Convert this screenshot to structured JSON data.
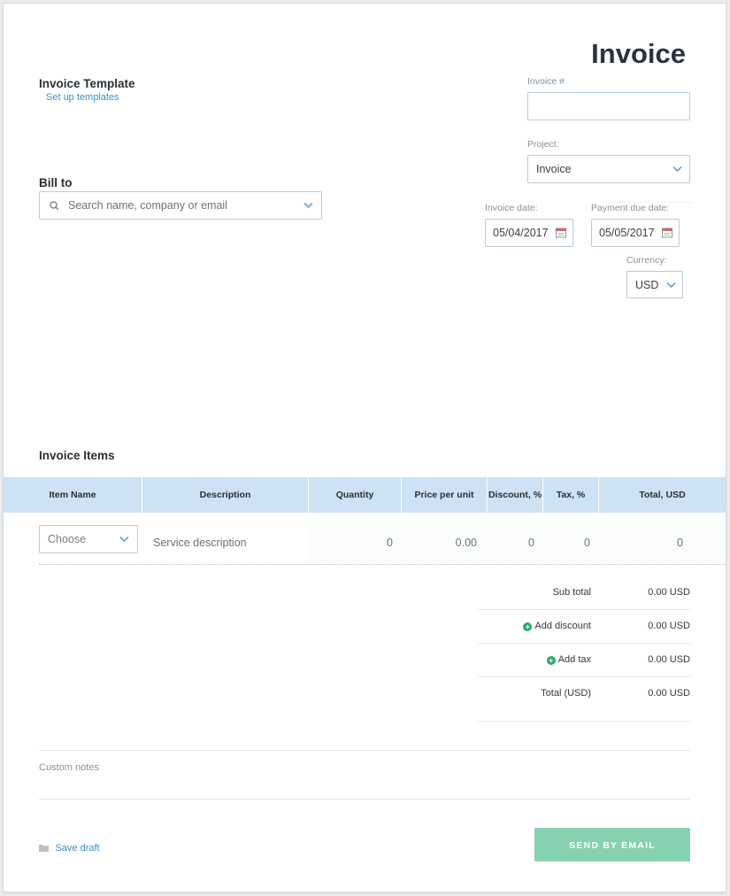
{
  "page": {
    "title": "Invoice",
    "template_heading": "Invoice Template",
    "template_link": "Set up templates"
  },
  "bill_to": {
    "label": "Bill to",
    "search_placeholder": "Search name, company or email"
  },
  "meta": {
    "invoice_number_label": "Invoice #",
    "invoice_number_value": "",
    "project_label": "Project:",
    "project_value": "Invoice",
    "invoice_date_label": "Invoice date:",
    "invoice_date_value": "05/04/2017",
    "due_date_label": "Payment due date:",
    "due_date_value": "05/05/2017",
    "currency_label": "Currency:",
    "currency_value": "USD"
  },
  "items": {
    "heading": "Invoice Items",
    "columns": [
      "Item Name",
      "Description",
      "Quantity",
      "Price per unit",
      "Discount, %",
      "Tax, %",
      "Total, USD"
    ],
    "row": {
      "item_placeholder": "Choose",
      "description_placeholder": "Service description",
      "quantity": "0",
      "price": "0.00",
      "discount": "0",
      "tax": "0",
      "total": "0"
    }
  },
  "totals": {
    "subtotal_label": "Sub total",
    "subtotal_value": "0.00 USD",
    "discount_label": "Add discount",
    "discount_value": "0.00 USD",
    "tax_label": "Add tax",
    "tax_value": "0.00 USD",
    "total_label": "Total (USD)",
    "total_value": "0.00 USD"
  },
  "notes": {
    "label": "Custom notes"
  },
  "footer": {
    "save_draft": "Save draft",
    "send_email": "SEND BY EMAIL"
  },
  "colors": {
    "accent_link": "#3a8ec9",
    "table_header": "#cde2f4",
    "send_button": "#86d1b0",
    "add_icon": "#2aa86a"
  },
  "icons": {
    "search": "search-icon",
    "chevron": "chevron-down-icon",
    "calendar": "calendar-icon",
    "add": "plus-circle-icon",
    "folder": "folder-icon"
  }
}
